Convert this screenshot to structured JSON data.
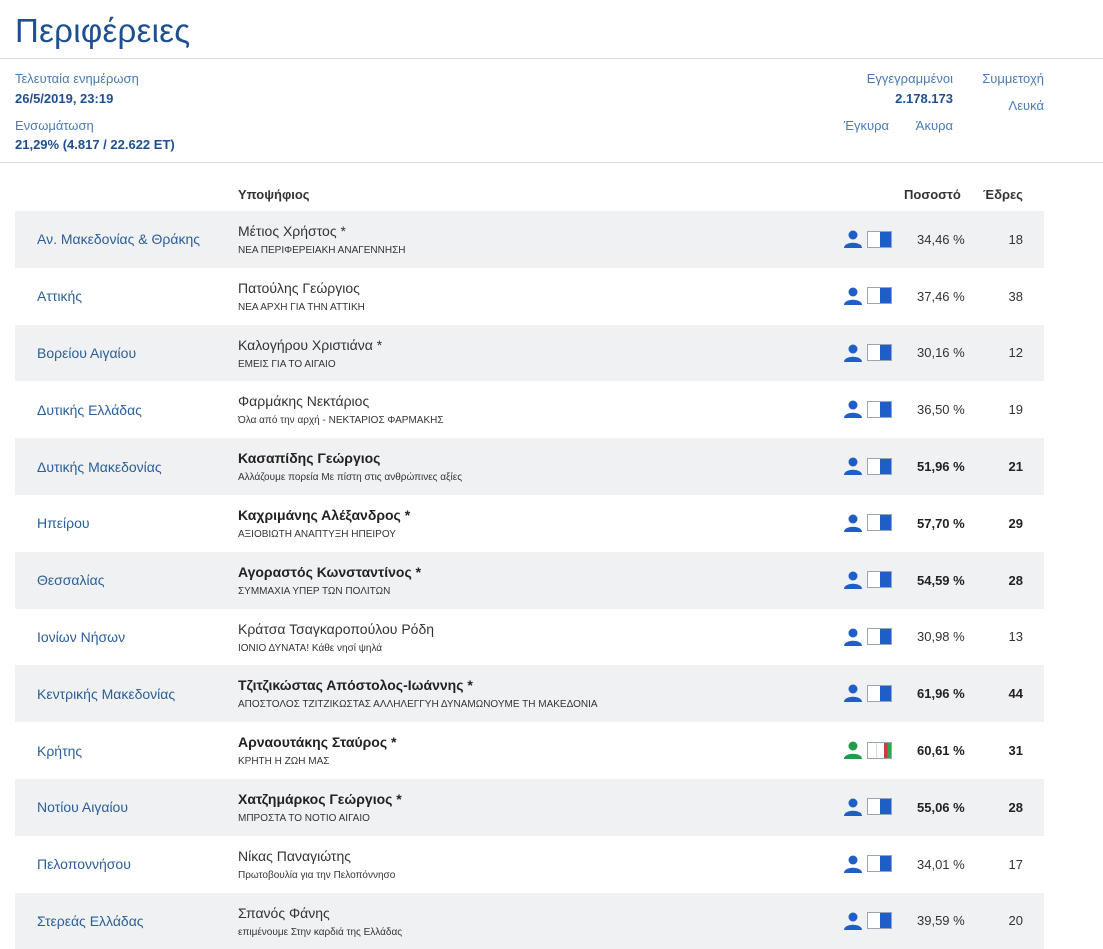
{
  "title": "Περιφέρειες",
  "stats": {
    "last_update_label": "Τελευταία ενημέρωση",
    "last_update_value": "26/5/2019, 23:19",
    "incorporation_label": "Ενσωμάτωση",
    "incorporation_value": "21,29% (4.817 / 22.622 ΕΤ)",
    "registered_label": "Εγγεγραμμένοι",
    "registered_value": "2.178.173",
    "participation_label": "Συμμετοχή",
    "blank_label": "Λευκά",
    "valid_label": "Έγκυρα",
    "invalid_label": "Άκυρα"
  },
  "table": {
    "col_candidate": "Υποψήφιος",
    "col_percent": "Ποσοστό",
    "col_seats": "Έδρες",
    "rows": [
      {
        "region": "Αν. Μακεδονίας & Θράκης",
        "candidate": "Μέτιος Χρήστος *",
        "party": "ΝΕΑ ΠΕΡΙΦΕΡΕΙΑΚΗ ΑΝΑΓΕΝΝΗΣΗ",
        "percent": "34,46 %",
        "seats": "18",
        "bold": false,
        "color": "#1d5fc6"
      },
      {
        "region": "Αττικής",
        "candidate": "Πατούλης Γεώργιος",
        "party": "ΝΕΑ ΑΡΧΗ ΓΙΑ ΤΗΝ ΑΤΤΙΚΗ",
        "percent": "37,46 %",
        "seats": "38",
        "bold": false,
        "color": "#1d5fc6"
      },
      {
        "region": "Βορείου Αιγαίου",
        "candidate": "Καλογήρου Χριστιάνα *",
        "party": "ΕΜΕΙΣ ΓΙΑ ΤΟ ΑΙΓΑΙΟ",
        "percent": "30,16 %",
        "seats": "12",
        "bold": false,
        "color": "#1d5fc6"
      },
      {
        "region": "Δυτικής Ελλάδας",
        "candidate": "Φαρμάκης Νεκτάριος",
        "party": "Όλα από την αρχή - ΝΕΚΤΑΡΙΟΣ ΦΑΡΜΑΚΗΣ",
        "percent": "36,50 %",
        "seats": "19",
        "bold": false,
        "color": "#1d5fc6"
      },
      {
        "region": "Δυτικής Μακεδονίας",
        "candidate": "Κασαπίδης Γεώργιος",
        "party": "Αλλάζουμε πορεία Με πίστη στις ανθρώπινες αξίες",
        "percent": "51,96 %",
        "seats": "21",
        "bold": true,
        "color": "#1d5fc6"
      },
      {
        "region": "Ηπείρου",
        "candidate": "Καχριμάνης Αλέξανδρος *",
        "party": "ΑΞΙΟΒΙΩΤΗ ΑΝΑΠΤΥΞΗ ΗΠΕΙΡΟΥ",
        "percent": "57,70 %",
        "seats": "29",
        "bold": true,
        "color": "#1d5fc6"
      },
      {
        "region": "Θεσσαλίας",
        "candidate": "Αγοραστός Κωνσταντίνος *",
        "party": "ΣΥΜΜΑΧΙΑ ΥΠΕΡ ΤΩΝ ΠΟΛΙΤΩΝ",
        "percent": "54,59 %",
        "seats": "28",
        "bold": true,
        "color": "#1d5fc6"
      },
      {
        "region": "Ιονίων Νήσων",
        "candidate": "Κράτσα Τσαγκαροπούλου Ρόδη",
        "party": "ΙΟΝΙΟ ΔΥΝΑΤΑ! Κάθε νησί ψηλά",
        "percent": "30,98 %",
        "seats": "13",
        "bold": false,
        "color": "#1d5fc6"
      },
      {
        "region": "Κεντρικής Μακεδονίας",
        "candidate": "Τζιτζικώστας Απόστολος-Ιωάννης *",
        "party": "ΑΠΟΣΤΟΛΟΣ ΤΖΙΤΖΙΚΩΣΤΑΣ ΑΛΛΗΛΕΓΓΥΗ ΔΥΝΑΜΩΝΟΥΜΕ ΤΗ ΜΑΚΕΔΟΝΙΑ",
        "percent": "61,96 %",
        "seats": "44",
        "bold": true,
        "color": "#1d5fc6"
      },
      {
        "region": "Κρήτης",
        "candidate": "Αρναουτάκης Σταύρος *",
        "party": "ΚΡΗΤΗ Η ΖΩΗ ΜΑΣ",
        "percent": "60,61 %",
        "seats": "31",
        "bold": true,
        "color": "#1f9b4a"
      },
      {
        "region": "Νοτίου Αιγαίου",
        "candidate": "Χατζημάρκος Γεώργιος *",
        "party": "ΜΠΡΟΣΤΑ ΤΟ ΝΟΤΙΟ ΑΙΓΑΙΟ",
        "percent": "55,06 %",
        "seats": "28",
        "bold": true,
        "color": "#1d5fc6"
      },
      {
        "region": "Πελοποννήσου",
        "candidate": "Νίκας Παναγιώτης",
        "party": "Πρωτοβουλία για την Πελοπόννησο",
        "percent": "34,01 %",
        "seats": "17",
        "bold": false,
        "color": "#1d5fc6"
      },
      {
        "region": "Στερεάς Ελλάδας",
        "candidate": "Σπανός Φάνης",
        "party": "επιμένουμε Στην καρδιά της Ελλάδας",
        "percent": "39,59 %",
        "seats": "20",
        "bold": false,
        "color": "#1d5fc6"
      }
    ]
  }
}
